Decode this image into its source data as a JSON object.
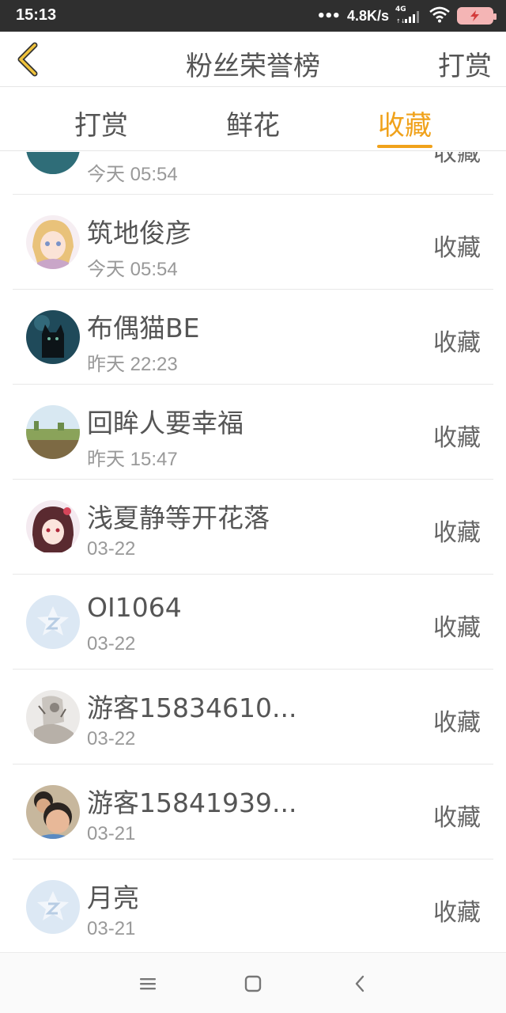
{
  "status_bar": {
    "time": "15:13",
    "net_speed": "4.8K/s",
    "network_type": "4G",
    "battery_icon": "battery-charging-icon"
  },
  "header": {
    "back_icon": "chevron-left-icon",
    "title": "粉丝荣誉榜",
    "right_action": "打赏"
  },
  "tabs": [
    {
      "label": "打赏",
      "active": false
    },
    {
      "label": "鲜花",
      "active": false
    },
    {
      "label": "收藏",
      "active": true
    }
  ],
  "colors": {
    "accent": "#f0a21b",
    "status_bar_bg": "#2f2f2f",
    "text_primary": "#555555",
    "text_secondary": "#999999",
    "divider": "#e8e8e8"
  },
  "fans": [
    {
      "name": "",
      "time": "今天 05:54",
      "action": "收藏",
      "avatar": "teal-scene-avatar"
    },
    {
      "name": "筑地俊彦",
      "time": "今天 05:54",
      "action": "收藏",
      "avatar": "anime-girl-avatar"
    },
    {
      "name": "布偶猫BE",
      "time": "昨天 22:23",
      "action": "收藏",
      "avatar": "black-cat-avatar"
    },
    {
      "name": "回眸人要幸福",
      "time": "昨天 15:47",
      "action": "收藏",
      "avatar": "landscape-avatar"
    },
    {
      "name": "浅夏静等开花落",
      "time": "03-22",
      "action": "收藏",
      "avatar": "anime-red-avatar"
    },
    {
      "name": "OI1064",
      "time": "03-22",
      "action": "收藏",
      "avatar": "default-star-avatar"
    },
    {
      "name": "游客15834610...",
      "time": "03-22",
      "action": "收藏",
      "avatar": "sketch-avatar"
    },
    {
      "name": "游客15841939...",
      "time": "03-21",
      "action": "收藏",
      "avatar": "child-photo-avatar"
    },
    {
      "name": "月亮",
      "time": "03-21",
      "action": "收藏",
      "avatar": "default-star-avatar"
    }
  ],
  "nav_bar": {
    "menu_icon": "menu-icon",
    "home_icon": "home-square-icon",
    "back_icon": "back-triangle-icon"
  }
}
